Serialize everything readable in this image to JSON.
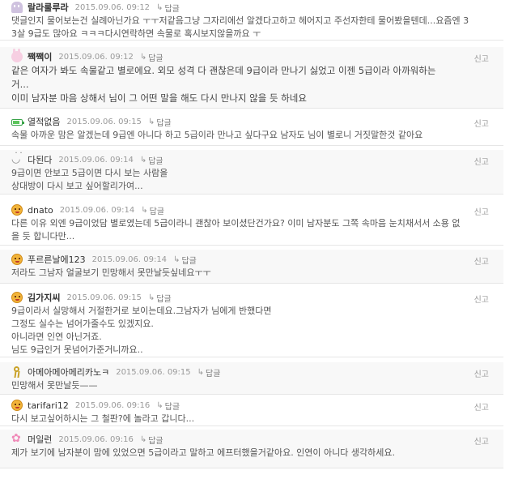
{
  "labels": {
    "reply": "답글",
    "report": "신고",
    "reply_arrow": "↳"
  },
  "colors": {
    "alt_background": "#f8f8f8",
    "meta_text": "#999999",
    "body_text": "#555555"
  },
  "comments": [
    {
      "avatar": "ghost-icon",
      "nickname": "랄라룰루라",
      "date": "2015.09.06. 09:12",
      "lines": [
        "댓글인지 물어보는건 실례아닌가요 ㅜㅜ저같음그냥 그자리에선 알겠다고하고 헤어지고 주선자한테 물어봤을텐데...요즘엔 3",
        "3살 9급도 많아요 ㅋㅋㅋ다시연락하면 속물로 혹시보지않을까요 ㅜ"
      ]
    },
    {
      "avatar": "bunny-icon",
      "nickname": "짹짹이",
      "date": "2015.09.06. 09:12",
      "lines": [
        "같은 여자가 봐도 속물같고 별로에요. 외모 성격 다 괜찮은데 9급이라 만나기 싫었고 이젠 5급이라 아까워하는",
        "거...",
        "이미 남자분 마음 상해서 님이 그 어떤 말을 해도 다시 만나지 않을 듯 하네요"
      ]
    },
    {
      "avatar": "battery-icon",
      "nickname": "열적없음",
      "date": "2015.09.06. 09:15",
      "lines": [
        "속물 아까운 맘은 알겠는데 9급엔 아니다 하고 5급이라 만나고 싶다구요 남자도 님이 별로니 거짓말한것 같아요"
      ]
    },
    {
      "avatar": "smile-icon",
      "nickname": "다된다",
      "date": "2015.09.06. 09:14",
      "lines": [
        "9급이면 안보고 5급이면 다시 보는 사람을",
        "상대방이 다시 보고 싶어할리가여..."
      ]
    },
    {
      "avatar": "face-icon",
      "nickname": "dnato",
      "date": "2015.09.06. 09:14",
      "lines": [
        "다른 이유 외엔 9급이었담 별로였는데 5급이라니 괜찮아 보이셨단건가요? 이미 남자분도 그쪽 속마음 눈치채서서 소용 없",
        "을 듯 합니다만..."
      ]
    },
    {
      "avatar": "face-icon",
      "nickname": "푸르른날에123",
      "date": "2015.09.06. 09:14",
      "lines": [
        "저라도 그남자 얼굴보기 민망해서 못만날듯싶네요ㅜㅜ"
      ]
    },
    {
      "avatar": "face-icon",
      "nickname": "김가지씨",
      "date": "2015.09.06. 09:15",
      "lines": [
        "9급이라서 실망해서 거절한거로 보이는데요.그남자가 님에게 반했다면",
        "그정도 실수는 넘어가줄수도 있겠지요.",
        "아니라면 인연 아닌거죠.",
        "님도 9급인거 못넘어가준거니까요.."
      ]
    },
    {
      "avatar": "ribbon-icon",
      "nickname": "아메아메아메리카노ㅋ",
      "date": "2015.09.06. 09:15",
      "lines": [
        "민망해서 못만날듯——"
      ]
    },
    {
      "avatar": "face-icon",
      "nickname": "tarifari12",
      "date": "2015.09.06. 09:16",
      "lines": [
        "다시 보고싶어하시는 그 철판?에 놀라고 갑니다..."
      ]
    },
    {
      "avatar": "flower-icon",
      "nickname": "머일런",
      "date": "2015.09.06. 09:16",
      "lines": [
        "제가 보기에 남자분이 맘에 있었으면 5급이라고 말하고 에프터했을거같아요. 인연이 아니다 생각하세요."
      ]
    }
  ]
}
